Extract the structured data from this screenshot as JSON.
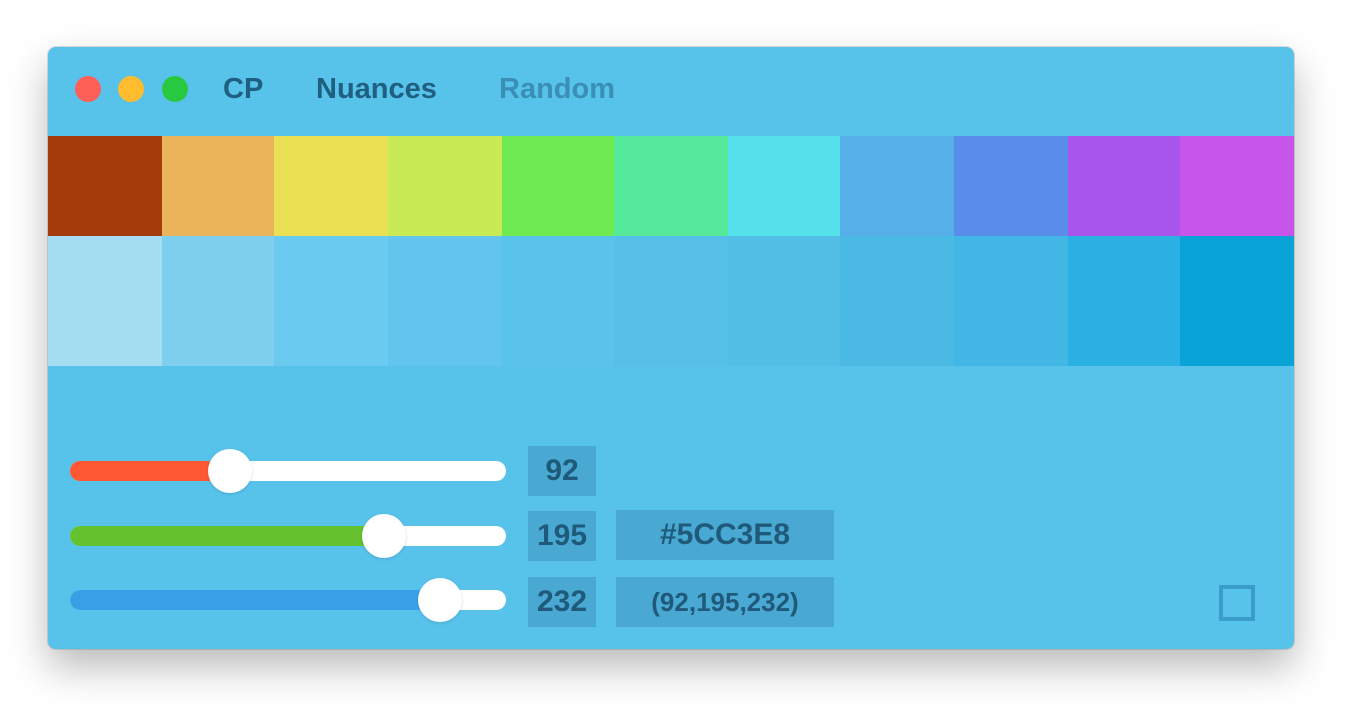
{
  "window": {
    "background": "#57c2ea",
    "traffic_lights": {
      "close": "#fe5f57",
      "minimize": "#febc2e",
      "maximize": "#28c840"
    }
  },
  "tabs": [
    {
      "label": "CP",
      "active": true
    },
    {
      "label": "Nuances",
      "active": true
    },
    {
      "label": "Random",
      "active": false
    }
  ],
  "hue_swatches": [
    "#a53a0b",
    "#eab55a",
    "#e9e053",
    "#c8ea55",
    "#6eea52",
    "#55ea9b",
    "#55e2ea",
    "#55b0ea",
    "#5a8cea",
    "#a755ea",
    "#c855ea"
  ],
  "nuance_swatches": [
    "#a5ddf3",
    "#7ecfee",
    "#6bcaef",
    "#62c5ed",
    "#5ac3eb",
    "#57c0e8",
    "#53bee6",
    "#4ab9e3",
    "#42b7e5",
    "#2bb0e4",
    "#0aa3d8"
  ],
  "sliders": [
    {
      "channel": "red",
      "value": 92,
      "max": 255,
      "fill_color": "#fe5733",
      "label": "92"
    },
    {
      "channel": "green",
      "value": 195,
      "max": 255,
      "fill_color": "#63c22d",
      "label": "195"
    },
    {
      "channel": "blue",
      "value": 232,
      "max": 255,
      "fill_color": "#3aa0e6",
      "label": "232"
    }
  ],
  "color_readout": {
    "hex": "#5CC3E8",
    "rgb": "(92,195,232)"
  },
  "checkbox": {
    "checked": false
  }
}
